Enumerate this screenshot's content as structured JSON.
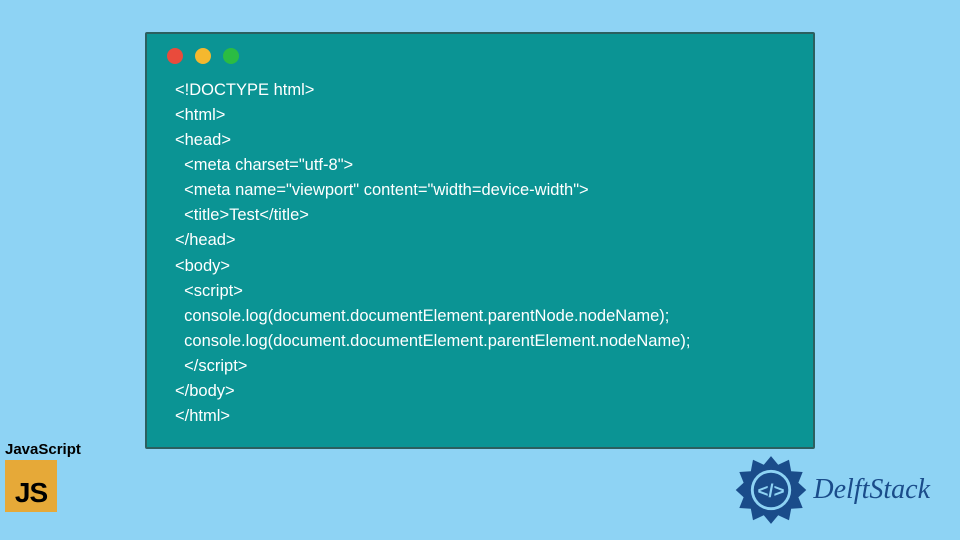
{
  "code": {
    "lines": [
      "<!DOCTYPE html>",
      "<html>",
      "<head>",
      "  <meta charset=\"utf-8\">",
      "  <meta name=\"viewport\" content=\"width=device-width\">",
      "  <title>Test</title>",
      "</head>",
      "<body>",
      "  <script>",
      "  console.log(document.documentElement.parentNode.nodeName);",
      "  console.log(document.documentElement.parentElement.nodeName);",
      "  </script>",
      "</body>",
      "</html>"
    ]
  },
  "badges": {
    "js_label": "JavaScript",
    "js_icon_text": "JS",
    "delft_text": "DelftStack"
  },
  "colors": {
    "background": "#8ed3f4",
    "window_bg": "#0b9494",
    "window_border": "#2c5f5f",
    "dot_red": "#e94b3c",
    "dot_yellow": "#f5b82e",
    "dot_green": "#2bbc43",
    "js_badge": "#e6a938",
    "delft_blue": "#1a4c8a"
  }
}
